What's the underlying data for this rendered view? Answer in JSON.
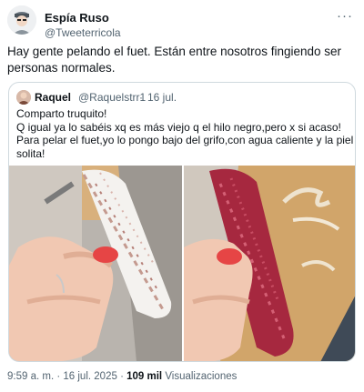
{
  "tweet": {
    "author_name": "Espía Ruso",
    "author_handle": "@Tweeterricola",
    "more_icon": "ellipsis-icon",
    "text": "Hay gente pelando el fuet. Están entre nosotros fingiendo ser personas normales."
  },
  "quoted": {
    "author_name": "Raquel",
    "author_handle": "@Raquelstrr1",
    "separator": "·",
    "date": "16 jul.",
    "lines": [
      "Comparto truquito!",
      "Q igual ya lo sabéis xq es más viejo q el hilo negro,pero x si acaso!",
      "Para pelar el fuet,yo lo pongo bajo del grifo,con agua caliente y la piel sale",
      "solita!"
    ]
  },
  "footer": {
    "time": "9:59 a. m.",
    "separator": "·",
    "date": "16 jul. 2025",
    "views_count": "109 mil",
    "views_label": "Visualizaciones"
  },
  "colors": {
    "text_primary": "#0f1419",
    "text_secondary": "#536471",
    "border": "#cfd9de"
  }
}
